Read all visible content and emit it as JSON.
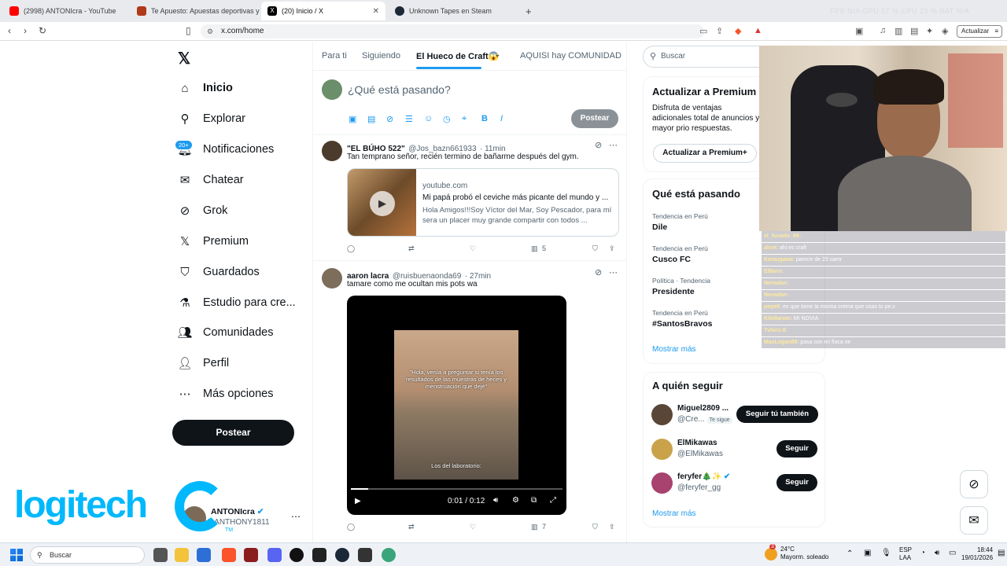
{
  "browser": {
    "tabs": [
      {
        "title": "(2998) ANTONIcra - YouTube"
      },
      {
        "title": "Te Apuesto: Apuestas deportivas y Ca"
      },
      {
        "title": "(20) Inicio / X"
      },
      {
        "title": "Unknown Tapes en Steam"
      }
    ],
    "url": "x.com/home",
    "update_label": "Actualizar",
    "overlay_stats": "FPS  N/A     GPU  17 %     CPU  23 %     BAT  N/A"
  },
  "nav": {
    "items": [
      {
        "label": "Inicio",
        "icon": "home-icon"
      },
      {
        "label": "Explorar",
        "icon": "search-icon"
      },
      {
        "label": "Notificaciones",
        "icon": "bell-icon"
      },
      {
        "label": "Chatear",
        "icon": "mail-icon"
      },
      {
        "label": "Grok",
        "icon": "grok-icon"
      },
      {
        "label": "Premium",
        "icon": "x-logo-icon"
      },
      {
        "label": "Guardados",
        "icon": "bookmark-icon"
      },
      {
        "label": "Estudio para cre...",
        "icon": "flask-icon"
      },
      {
        "label": "Comunidades",
        "icon": "people-icon"
      },
      {
        "label": "Perfil",
        "icon": "person-icon"
      },
      {
        "label": "Más opciones",
        "icon": "more-icon"
      }
    ],
    "notif_badge": "20+",
    "post_label": "Postear",
    "account_name": "ANTONIcra",
    "account_handle": "@ANTHONY1811"
  },
  "timeline": {
    "tabs": [
      "Para ti",
      "Siguiendo",
      "El Hueco de Craft😱",
      "AQUISI hay COMUNIDAD"
    ],
    "compose_placeholder": "¿Qué está pasando?",
    "post_label": "Postear",
    "tweets": [
      {
        "name": "\"EL BÚHO 522\"",
        "handle": "@Jos_bazn661933",
        "time": "· 11min",
        "text": "Tan temprano señor, recién termino de bañarme después del gym.",
        "card": {
          "domain": "youtube.com",
          "title": "Mi papá probó el ceviche más picante del mundo y ...",
          "desc": "Hola Amigos!!!Soy Víctor del Mar, Soy Pescador, para mí sera un placer muy grande compartir con todos ..."
        },
        "views": "5"
      },
      {
        "name": "aaron lacra",
        "handle": "@ruisbuenaonda69",
        "time": "· 27min",
        "text": "tamare como me ocultan mis pots wa",
        "video": {
          "caption_top": "\"Hola, venía a preguntar si tenía los resultados de las muestras de heces y menstruación que dejé\"",
          "caption_bottom": "Los del laboratorio:",
          "time": "0:01 / 0:12",
          "progress": 0.08
        },
        "views": "7"
      }
    ]
  },
  "right": {
    "search_placeholder": "Buscar",
    "premium": {
      "title": "Actualizar a Premium",
      "text": "Disfruta de ventajas adicionales total de anuncios y mayor prio respuestas.",
      "button": "Actualizar a Premium+"
    },
    "trends_title": "Qué está pasando",
    "trends": [
      {
        "category": "Tendencia en Perú",
        "name": "Dile"
      },
      {
        "category": "Tendencia en Perú",
        "name": "Cusco FC"
      },
      {
        "category": "Política · Tendencia",
        "name": "Presidente"
      },
      {
        "category": "Tendencia en Perú",
        "name": "#SantosBravos"
      }
    ],
    "show_more": "Mostrar más",
    "follow_title": "A quién seguir",
    "follow": [
      {
        "name": "Miguel2809 ...",
        "handle": "@Cre...",
        "follows_you": "Te sigue",
        "button": "Seguir tú también"
      },
      {
        "name": "ElMikawas",
        "handle": "@ElMikawas",
        "button": "Seguir"
      },
      {
        "name": "feryfer🎄✨",
        "handle": "@feryfer_gg",
        "button": "Seguir"
      }
    ],
    "show_more_2": "Mostrar más"
  },
  "chat": [
    {
      "user": "el_funado_69",
      "msg": ":"
    },
    {
      "user": "alcet",
      "msg": ": ahi es craft"
    },
    {
      "user": "Kamugawa",
      "msg": ": parece de 23 camr"
    },
    {
      "user": "ElBaro",
      "msg": ":"
    },
    {
      "user": "Nevadan",
      "msg": ":"
    },
    {
      "user": "Nevadan",
      "msg": ":"
    },
    {
      "user": "pepe6",
      "msg": ": es que tiene la misma crema que usas tu pe.v"
    },
    {
      "user": "Kikillarom",
      "msg": ": MI NOVIA"
    },
    {
      "user": "Tvbiro.tl",
      "msg": ":"
    },
    {
      "user": "MaxLogan88",
      "msg": ": pasa con mi flaca oe"
    }
  ],
  "overlay": {
    "brand": "logitech",
    "tm": "TM"
  },
  "taskbar": {
    "search": "Buscar",
    "weather_temp": "24°C",
    "weather_desc": "Mayorm. soleado",
    "weather_badge": "3",
    "lang1": "ESP",
    "lang2": "LAA",
    "time": "18:44",
    "date": "19/01/2026"
  }
}
